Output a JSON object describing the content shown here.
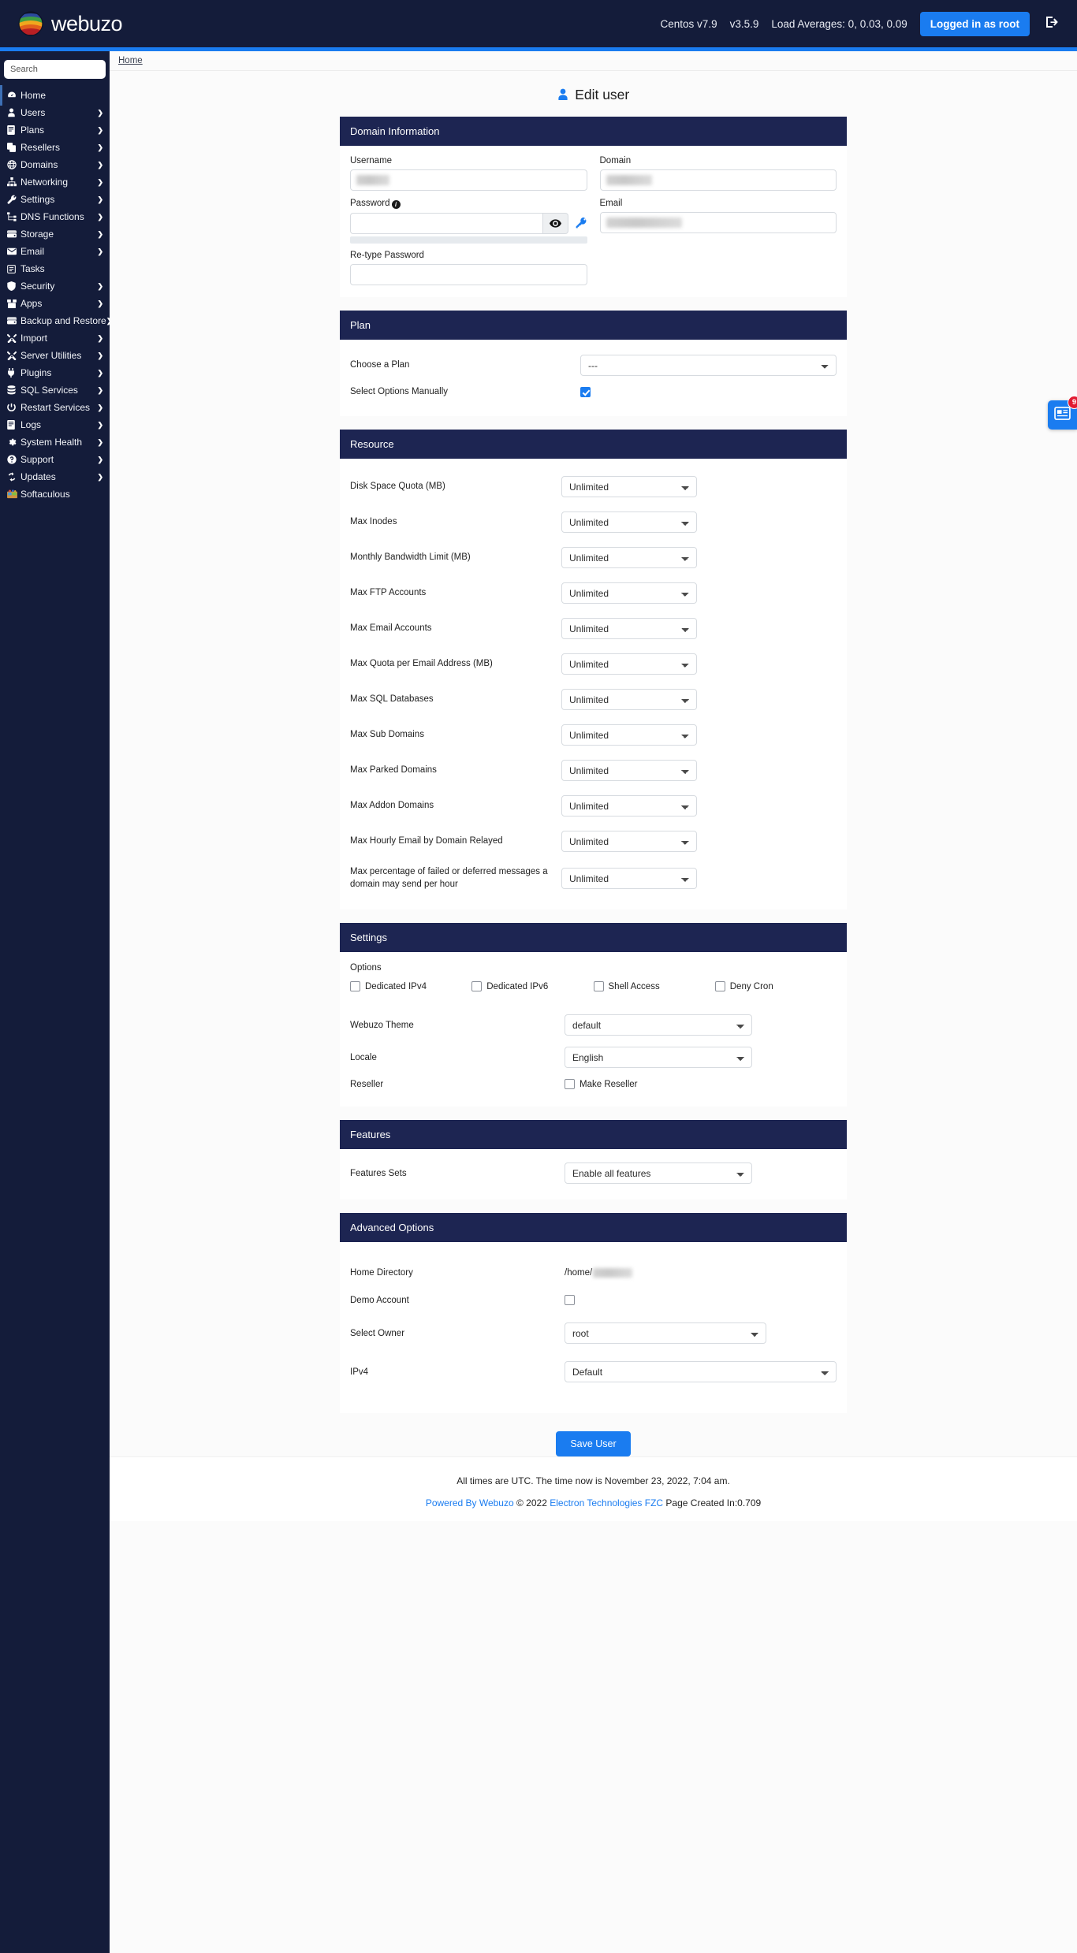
{
  "header": {
    "brand": "webuzo",
    "os_version": "Centos v7.9",
    "app_version": "v3.5.9",
    "load_averages": "Load Averages: 0, 0.03, 0.09",
    "login_status": "Logged in as root",
    "logout_icon": "logout-icon",
    "accent_color": "#1a7cf0",
    "bar_color": "#141c3a"
  },
  "sidebar": {
    "search_placeholder": "Search",
    "items": [
      {
        "label": "Home",
        "icon": "gauge-icon",
        "arrow": false,
        "active": true
      },
      {
        "label": "Users",
        "icon": "user-icon",
        "arrow": true,
        "active": false
      },
      {
        "label": "Plans",
        "icon": "book-icon",
        "arrow": true,
        "active": false
      },
      {
        "label": "Resellers",
        "icon": "copy-icon",
        "arrow": true,
        "active": false
      },
      {
        "label": "Domains",
        "icon": "globe-icon",
        "arrow": true,
        "active": false
      },
      {
        "label": "Networking",
        "icon": "sitemap-icon",
        "arrow": true,
        "active": false
      },
      {
        "label": "Settings",
        "icon": "wrench-icon",
        "arrow": true,
        "active": false
      },
      {
        "label": "DNS Functions",
        "icon": "dns-icon",
        "arrow": true,
        "active": false
      },
      {
        "label": "Storage",
        "icon": "hdd-icon",
        "arrow": true,
        "active": false
      },
      {
        "label": "Email",
        "icon": "envelope-icon",
        "arrow": true,
        "active": false
      },
      {
        "label": "Tasks",
        "icon": "list-icon",
        "arrow": false,
        "active": false
      },
      {
        "label": "Security",
        "icon": "shield-icon",
        "arrow": true,
        "active": false
      },
      {
        "label": "Apps",
        "icon": "box-icon",
        "arrow": true,
        "active": false
      },
      {
        "label": "Backup and Restore",
        "icon": "hdd-icon",
        "arrow": true,
        "active": false
      },
      {
        "label": "Import",
        "icon": "tools-icon",
        "arrow": true,
        "active": false
      },
      {
        "label": "Server Utilities",
        "icon": "tools-icon",
        "arrow": true,
        "active": false
      },
      {
        "label": "Plugins",
        "icon": "plug-icon",
        "arrow": true,
        "active": false
      },
      {
        "label": "SQL Services",
        "icon": "database-icon",
        "arrow": true,
        "active": false
      },
      {
        "label": "Restart Services",
        "icon": "power-icon",
        "arrow": true,
        "active": false
      },
      {
        "label": "Logs",
        "icon": "book-icon",
        "arrow": true,
        "active": false
      },
      {
        "label": "System Health",
        "icon": "cog-icon",
        "arrow": true,
        "active": false
      },
      {
        "label": "Support",
        "icon": "question-icon",
        "arrow": true,
        "active": false
      },
      {
        "label": "Updates",
        "icon": "refresh-icon",
        "arrow": true,
        "active": false
      },
      {
        "label": "Softaculous",
        "icon": "softaculous-icon",
        "arrow": false,
        "active": false
      }
    ]
  },
  "breadcrumb": {
    "home": "Home"
  },
  "page": {
    "title": "Edit user",
    "title_icon": "user-icon"
  },
  "domain_information": {
    "heading": "Domain Information",
    "username_label": "Username",
    "username_value": "",
    "domain_label": "Domain",
    "domain_value": "",
    "password_label": "Password",
    "password_info_icon": "info-icon",
    "password_value": "",
    "show_password_icon": "eye-icon",
    "generate_password_icon": "key-icon",
    "email_label": "Email",
    "email_value": "",
    "retype_password_label": "Re-type Password",
    "retype_password_value": ""
  },
  "plan": {
    "heading": "Plan",
    "choose_plan_label": "Choose a Plan",
    "choose_plan_value": "---",
    "select_options_manually_label": "Select Options Manually",
    "select_options_manually_checked": true
  },
  "resource": {
    "heading": "Resource",
    "rows": [
      {
        "label": "Disk Space Quota (MB)",
        "value": "Unlimited"
      },
      {
        "label": "Max Inodes",
        "value": "Unlimited"
      },
      {
        "label": "Monthly Bandwidth Limit (MB)",
        "value": "Unlimited"
      },
      {
        "label": "Max FTP Accounts",
        "value": "Unlimited"
      },
      {
        "label": "Max Email Accounts",
        "value": "Unlimited"
      },
      {
        "label": "Max Quota per Email Address (MB)",
        "value": "Unlimited"
      },
      {
        "label": "Max SQL Databases",
        "value": "Unlimited"
      },
      {
        "label": "Max Sub Domains",
        "value": "Unlimited"
      },
      {
        "label": "Max Parked Domains",
        "value": "Unlimited"
      },
      {
        "label": "Max Addon Domains",
        "value": "Unlimited"
      },
      {
        "label": "Max Hourly Email by Domain Relayed",
        "value": "Unlimited"
      },
      {
        "label": "Max percentage of failed or deferred messages a domain may send per hour",
        "value": "Unlimited"
      }
    ]
  },
  "settings": {
    "heading": "Settings",
    "options_label": "Options",
    "options": [
      {
        "label": "Dedicated IPv4",
        "checked": false
      },
      {
        "label": "Dedicated IPv6",
        "checked": false
      },
      {
        "label": "Shell Access",
        "checked": false
      },
      {
        "label": "Deny Cron",
        "checked": false
      }
    ],
    "theme_label": "Webuzo Theme",
    "theme_value": "default",
    "locale_label": "Locale",
    "locale_value": "English",
    "reseller_label": "Reseller",
    "make_reseller_label": "Make Reseller",
    "make_reseller_checked": false
  },
  "features": {
    "heading": "Features",
    "features_sets_label": "Features Sets",
    "features_sets_value": "Enable all features"
  },
  "advanced_options": {
    "heading": "Advanced Options",
    "home_directory_label": "Home Directory",
    "home_directory_value": "/home/",
    "demo_account_label": "Demo Account",
    "demo_account_checked": false,
    "select_owner_label": "Select Owner",
    "select_owner_value": "root",
    "ipv4_label": "IPv4",
    "ipv4_value": "Default"
  },
  "actions": {
    "save_label": "Save User"
  },
  "footer": {
    "time_note": "All times are UTC. The time now is November 23, 2022, 7:04 am.",
    "powered_by": "Powered By Webuzo",
    "copyright": "© 2022",
    "company": "Electron Technologies FZC",
    "page_created": "Page Created In:0.709"
  },
  "float_widget": {
    "icon": "news-icon",
    "badge": "9"
  }
}
